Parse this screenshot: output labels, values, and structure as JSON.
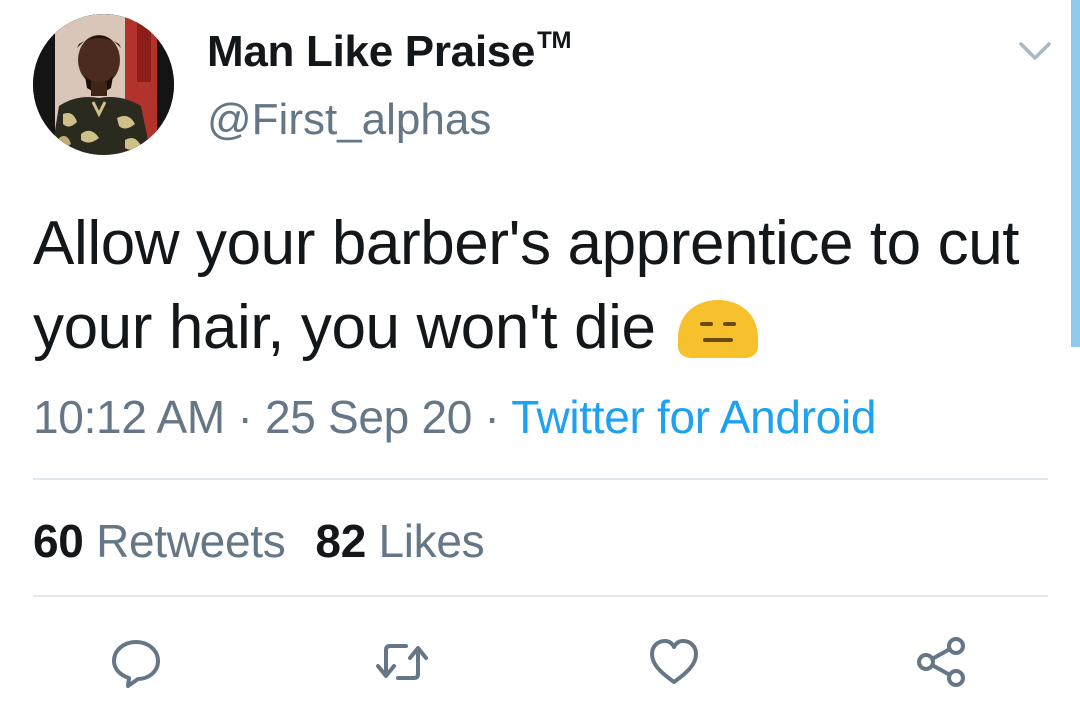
{
  "user": {
    "display_name": "Man Like Praise",
    "trademark": "TM",
    "handle": "@First_alphas"
  },
  "tweet": {
    "text": "Allow your barber's apprentice to cut your hair, you won't die",
    "emoji": "expressionless-face-emoji",
    "time": "10:12 AM",
    "date": "25 Sep 20",
    "separator": "·",
    "source": "Twitter for Android"
  },
  "stats": {
    "retweets_count": "60",
    "retweets_label": "Retweets",
    "likes_count": "82",
    "likes_label": "Likes"
  },
  "icons": {
    "caret": "chevron-down-icon",
    "reply": "reply-icon",
    "retweet": "retweet-icon",
    "like": "heart-icon",
    "share": "share-icon"
  },
  "colors": {
    "text_primary": "#14171a",
    "text_secondary": "#657786",
    "link": "#1da1f2",
    "divider": "#e1e8ed",
    "emoji": "#f6c12c"
  }
}
